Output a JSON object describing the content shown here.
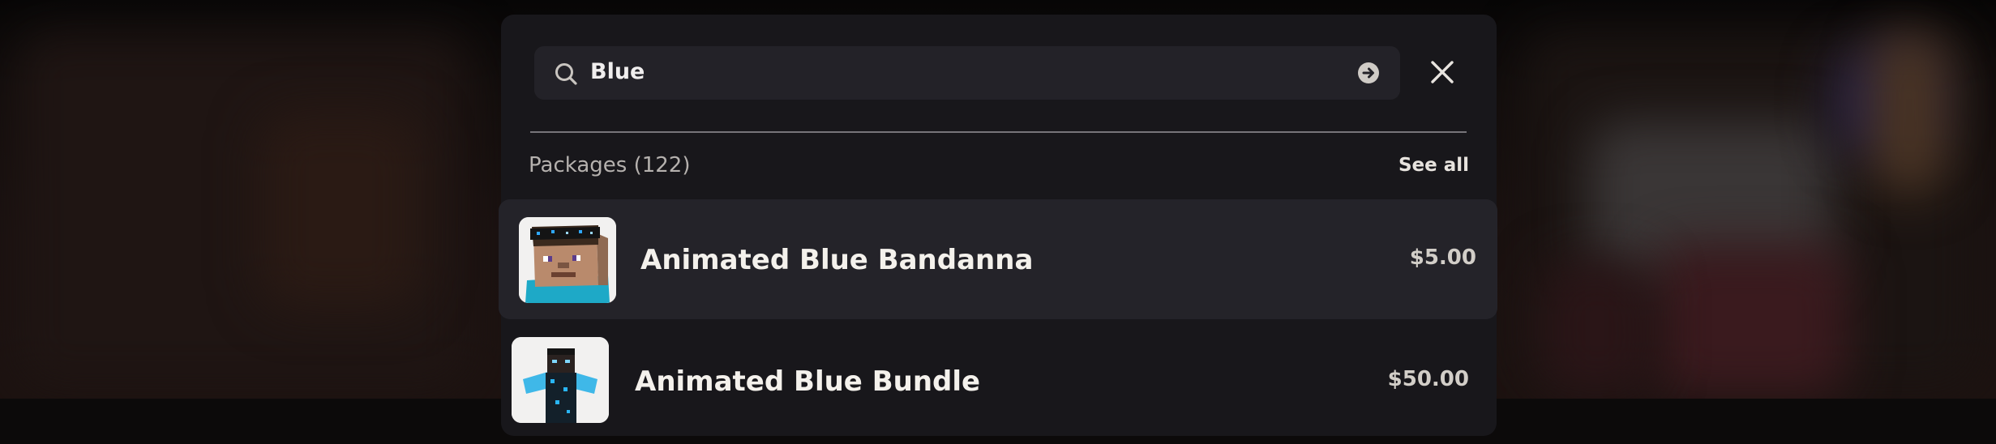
{
  "search": {
    "query": "Blue"
  },
  "packages_section": {
    "title": "Packages (122)",
    "see_all_label": "See all"
  },
  "results": [
    {
      "name": "Animated Blue Bandanna",
      "price": "$5.00",
      "thumbnail_icon": "steve-bandanna-thumbnail-icon"
    },
    {
      "name": "Animated Blue Bundle",
      "price": "$50.00",
      "thumbnail_icon": "blue-bundle-character-thumbnail-icon"
    }
  ],
  "colors": {
    "panel_bg": "#18171b",
    "search_bg": "#232228",
    "selected_row_bg": "#242329",
    "text_primary": "#f4f1ec",
    "text_secondary": "#b5b1ae"
  }
}
